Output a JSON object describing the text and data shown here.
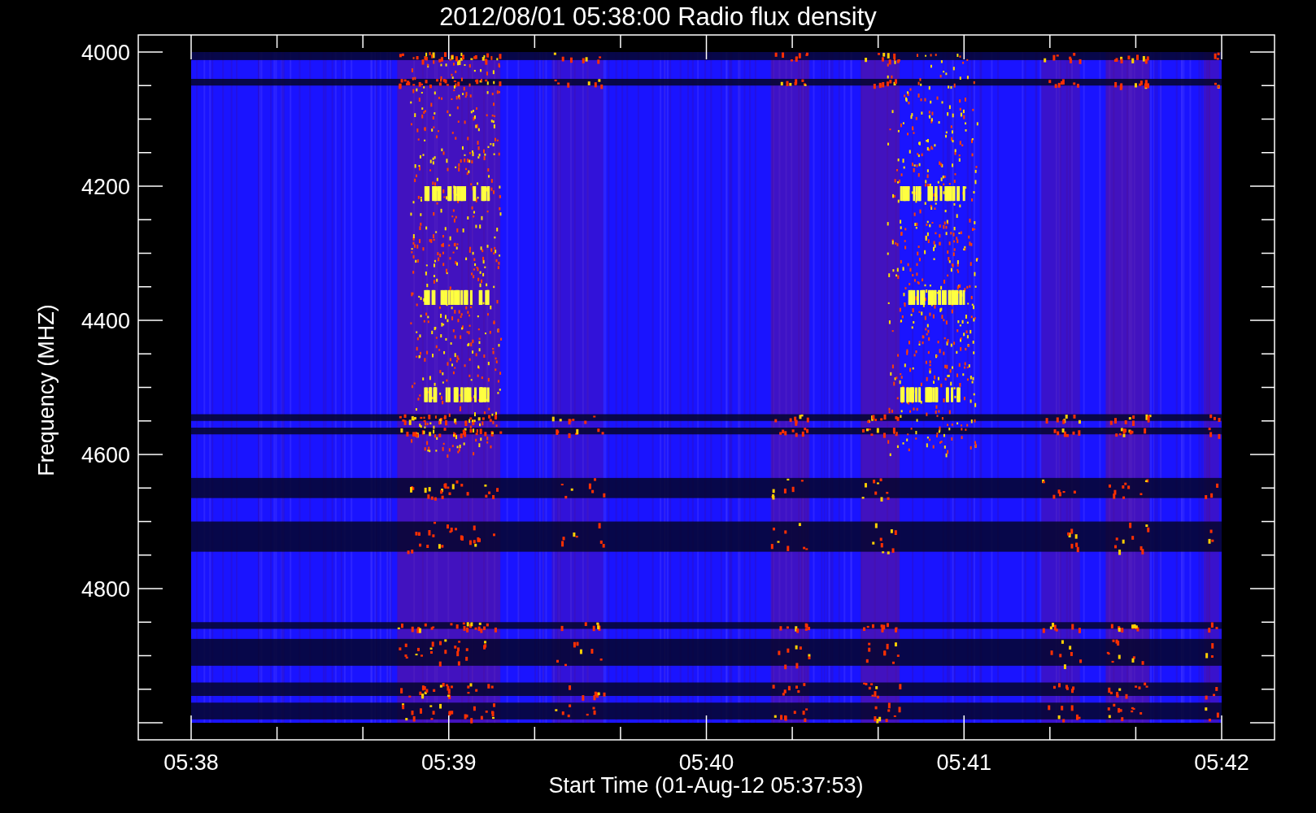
{
  "title": "2012/08/01 05:38:00 Radio flux density",
  "y_axis": {
    "label": "Frequency (MHZ)",
    "tick_labels": [
      "4000",
      "4200",
      "4400",
      "4600",
      "4800"
    ]
  },
  "x_axis": {
    "label": "Start Time (01-Aug-12 05:37:53)",
    "tick_labels": [
      "05:38",
      "05:39",
      "05:40",
      "05:41",
      "05:42"
    ]
  }
}
